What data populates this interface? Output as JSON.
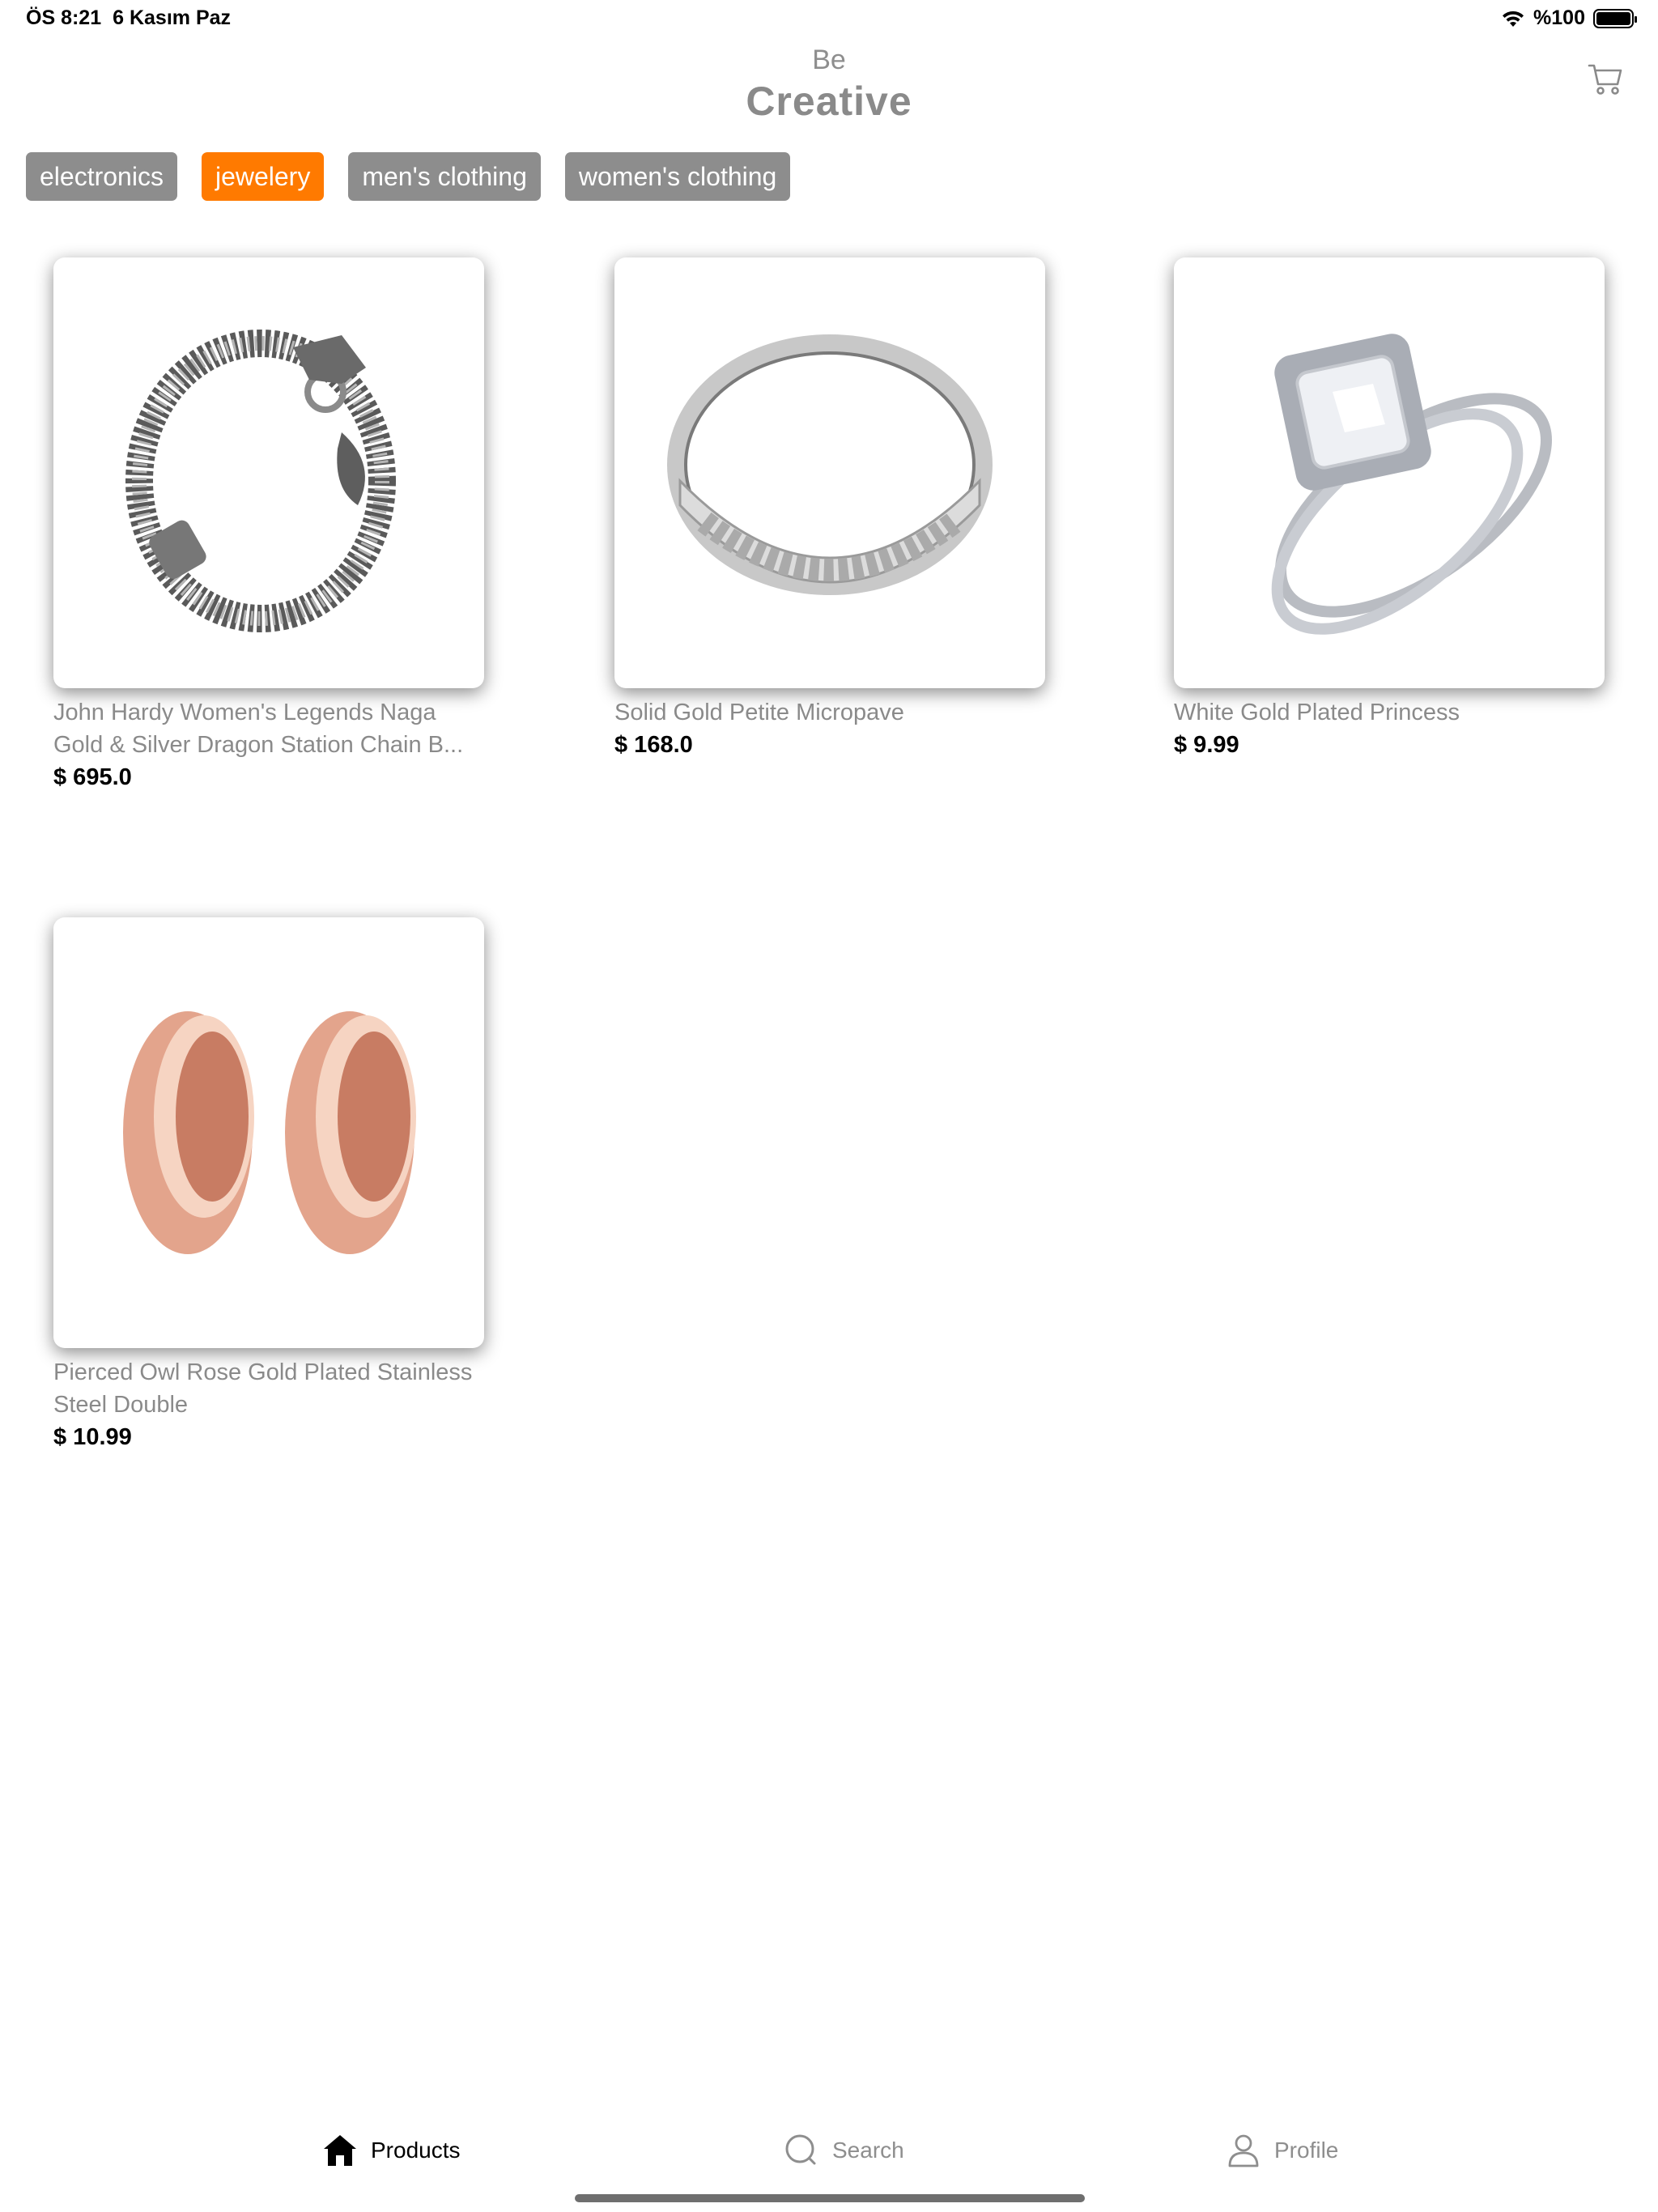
{
  "status_bar": {
    "time": "ÖS 8:21",
    "date": "6 Kasım Paz",
    "battery": "%100"
  },
  "header": {
    "brand_top": "Be",
    "brand_main": "Creative",
    "cart_icon": "cart-icon"
  },
  "categories": [
    {
      "label": "electronics",
      "active": false
    },
    {
      "label": "jewelery",
      "active": true
    },
    {
      "label": "men's clothing",
      "active": false
    },
    {
      "label": "women's clothing",
      "active": false
    }
  ],
  "products": [
    {
      "title": "John Hardy Women's Legends Naga Gold & Silver Dragon Station Chain B...",
      "price": "$ 695.0",
      "image_icon": "dragon-bracelet-image"
    },
    {
      "title": "Solid Gold Petite Micropave",
      "price": "$ 168.0",
      "image_icon": "silver-band-ring-image"
    },
    {
      "title": "White Gold Plated Princess",
      "price": "$ 9.99",
      "image_icon": "princess-ring-set-image"
    },
    {
      "title": "Pierced Owl Rose Gold Plated Stainless Steel Double",
      "price": "$ 10.99",
      "image_icon": "rose-gold-tunnels-image"
    }
  ],
  "tab_bar": {
    "tabs": [
      {
        "label": "Products",
        "icon": "home-icon",
        "active": true
      },
      {
        "label": "Search",
        "icon": "search-icon",
        "active": false
      },
      {
        "label": "Profile",
        "icon": "profile-icon",
        "active": false
      }
    ]
  },
  "colors": {
    "accent": "#ff7a00",
    "chip": "#8d8d8d",
    "muted_text": "#8a8a8a"
  }
}
